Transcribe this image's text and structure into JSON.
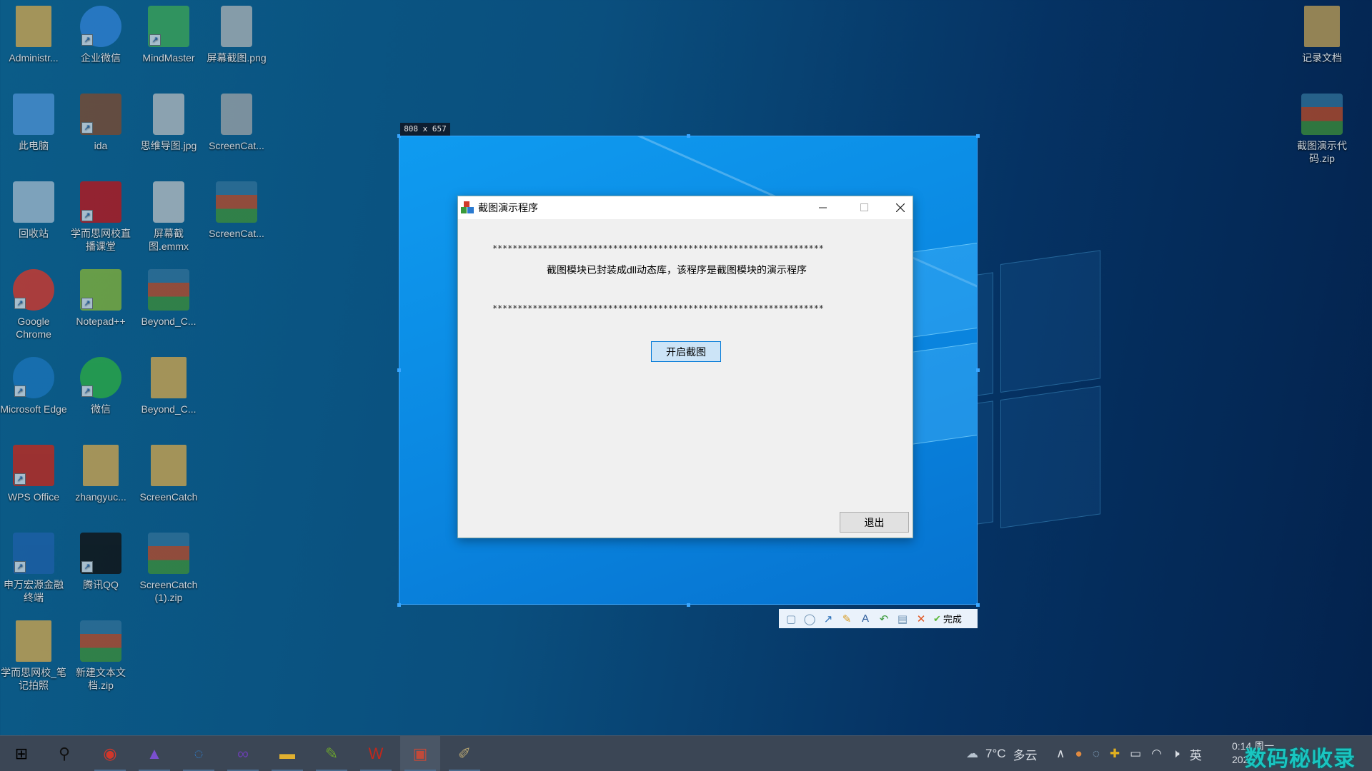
{
  "desktop": {
    "icons_left": [
      {
        "label": "Administr...",
        "icon": "user-folder-icon",
        "color": "#c9a24f",
        "shortcut": false
      },
      {
        "label": "企业微信",
        "icon": "wecom-icon",
        "color": "#2e7fd0",
        "shortcut": true
      },
      {
        "label": "MindMaster",
        "icon": "mindmaster-icon",
        "color": "#3aa256",
        "shortcut": true
      },
      {
        "label": "屏幕截图.png",
        "icon": "image-file-icon",
        "color": "#b9b9b9",
        "shortcut": false
      },
      {
        "label": "此电脑",
        "icon": "this-pc-icon",
        "color": "#4a8fcf",
        "shortcut": false
      },
      {
        "label": "ida",
        "icon": "ida-icon",
        "color": "#7a4a30",
        "shortcut": true
      },
      {
        "label": "思维导图.jpg",
        "icon": "image-file-icon",
        "color": "#c2c2c2",
        "shortcut": false
      },
      {
        "label": "ScreenCat...",
        "icon": "image-file-icon",
        "color": "#a9a9a9",
        "shortcut": false
      },
      {
        "label": "回收站",
        "icon": "recycle-bin-icon",
        "color": "#9ab4c8",
        "shortcut": false
      },
      {
        "label": "学而思网校直播课堂",
        "icon": "xueersi-icon",
        "color": "#b5161c",
        "shortcut": true
      },
      {
        "label": "屏幕截图.emmx",
        "icon": "document-icon",
        "color": "#c8c8c8",
        "shortcut": false
      },
      {
        "label": "ScreenCat...",
        "icon": "archive-icon",
        "color": "#b04a2a",
        "shortcut": false
      },
      {
        "label": "Google Chrome",
        "icon": "chrome-icon",
        "color": "#d1372b",
        "shortcut": true
      },
      {
        "label": "Notepad++",
        "icon": "notepad-plus-plus-icon",
        "color": "#7fae3a",
        "shortcut": true
      },
      {
        "label": "Beyond_C...",
        "icon": "archive-icon",
        "color": "#b04a2a",
        "shortcut": false
      },
      {
        "label": "Microsoft Edge",
        "icon": "edge-icon",
        "color": "#1a73b8",
        "shortcut": true
      },
      {
        "label": "微信",
        "icon": "wechat-icon",
        "color": "#2aa845",
        "shortcut": true
      },
      {
        "label": "Beyond_C...",
        "icon": "folder-icon",
        "color": "#c9a24f",
        "shortcut": false
      },
      {
        "label": "WPS Office",
        "icon": "wps-icon",
        "color": "#c0281c",
        "shortcut": true
      },
      {
        "label": "zhangyuc...",
        "icon": "folder-icon",
        "color": "#c9a24f",
        "shortcut": false
      },
      {
        "label": "ScreenCatch",
        "icon": "folder-icon",
        "color": "#c9a24f",
        "shortcut": false
      },
      {
        "label": "申万宏源金融终端",
        "icon": "swhy-icon",
        "color": "#1d5fa6",
        "shortcut": true
      },
      {
        "label": "腾讯QQ",
        "icon": "qq-icon",
        "color": "#111111",
        "shortcut": true
      },
      {
        "label": "ScreenCatch (1).zip",
        "icon": "archive-icon",
        "color": "#b04a2a",
        "shortcut": false
      },
      {
        "label": "学而思网校_笔记拍照",
        "icon": "folder-icon",
        "color": "#c9a24f",
        "shortcut": false
      },
      {
        "label": "新建文本文档.zip",
        "icon": "archive-icon",
        "color": "#b04a2a",
        "shortcut": false
      }
    ],
    "icons_right": [
      {
        "label": "记录文档",
        "icon": "folder-icon",
        "color": "#b89a55",
        "shortcut": false
      },
      {
        "label": "截图演示代码.zip",
        "icon": "archive-icon",
        "color": "#b04a2a",
        "shortcut": false
      }
    ]
  },
  "selection": {
    "size_label": "808 x 657"
  },
  "dialog": {
    "title": "截图演示程序",
    "stars": "******************************************************************",
    "message": "截图模块已封装成dll动态库，该程序是截图模块的演示程序",
    "start_button": "开启截图",
    "exit_button": "退出"
  },
  "capture_toolbar": {
    "tools": [
      {
        "icon": "rectangle-icon",
        "glyph": "▢",
        "color": "#6a8fb0"
      },
      {
        "icon": "ellipse-icon",
        "glyph": "◯",
        "color": "#6a8fb0"
      },
      {
        "icon": "arrow-icon",
        "glyph": "↗",
        "color": "#2a6fb8"
      },
      {
        "icon": "pencil-icon",
        "glyph": "✎",
        "color": "#d89a20"
      },
      {
        "icon": "text-icon",
        "glyph": "A",
        "color": "#2a5a9a"
      },
      {
        "icon": "undo-icon",
        "glyph": "↶",
        "color": "#3a9a3a"
      },
      {
        "icon": "save-icon",
        "glyph": "▤",
        "color": "#6a8fb0"
      },
      {
        "icon": "cancel-icon",
        "glyph": "✕",
        "color": "#e0521c"
      }
    ],
    "done_label": "完成",
    "done_color": "#5cb83a"
  },
  "taskbar": {
    "apps": [
      {
        "icon": "start-windows-icon",
        "glyph": "⊞",
        "color": "#000000",
        "running": false
      },
      {
        "icon": "search-icon",
        "glyph": "⚲",
        "color": "#111111",
        "running": false
      },
      {
        "icon": "chrome-icon",
        "glyph": "◉",
        "color": "#d1372b",
        "running": true
      },
      {
        "icon": "mindmaster-app-icon",
        "glyph": "▲",
        "color": "#7a4fd0",
        "running": true
      },
      {
        "icon": "wecom-icon",
        "glyph": "◌",
        "color": "#2e7fd0",
        "running": true
      },
      {
        "icon": "visual-studio-icon",
        "glyph": "∞",
        "color": "#6a3fb0",
        "running": true
      },
      {
        "icon": "file-explorer-icon",
        "glyph": "▬",
        "color": "#e0b030",
        "running": true
      },
      {
        "icon": "notepad-plus-plus-icon",
        "glyph": "✎",
        "color": "#6aa030",
        "running": true
      },
      {
        "icon": "wps-icon",
        "glyph": "W",
        "color": "#c0281c",
        "running": true
      },
      {
        "icon": "mfc-app-icon",
        "glyph": "▣",
        "color": "#c04a3a",
        "running": true
      },
      {
        "icon": "paint-icon",
        "glyph": "✐",
        "color": "#b0a070",
        "running": true
      }
    ],
    "weather": {
      "temp": "7°C",
      "condition": "多云"
    },
    "input_method": "英",
    "time": "0:14 周一",
    "date": "202",
    "watermark": "数码秘收录"
  }
}
